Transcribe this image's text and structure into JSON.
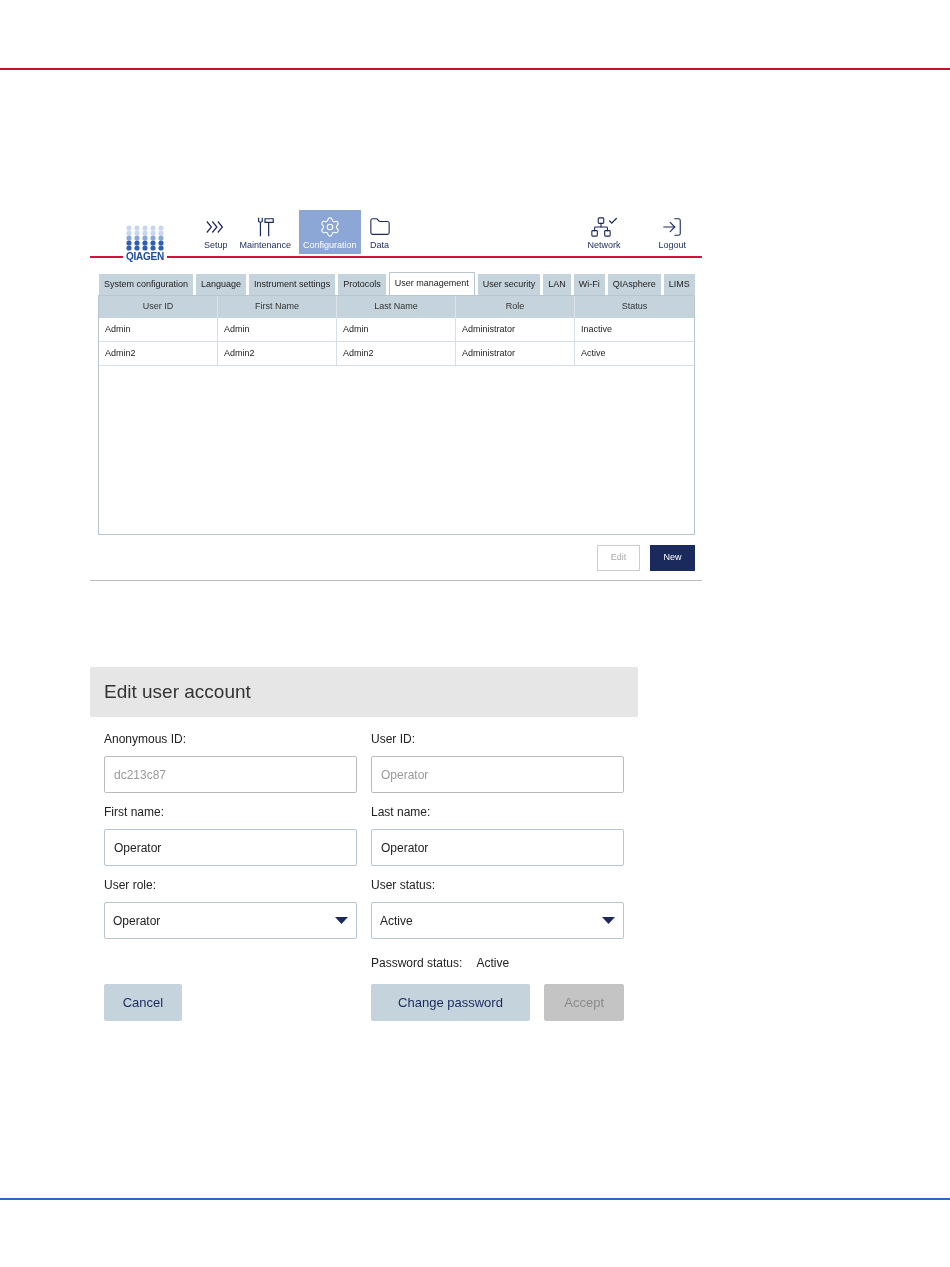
{
  "app": {
    "logo": "QIAGEN",
    "nav": [
      {
        "label": "Setup",
        "kind": "setup",
        "selected": false
      },
      {
        "label": "Maintenance",
        "kind": "maintenance",
        "selected": false
      },
      {
        "label": "Configuration",
        "kind": "configuration",
        "selected": true
      },
      {
        "label": "Data",
        "kind": "data",
        "selected": false
      }
    ],
    "nav_right": [
      {
        "label": "Network",
        "kind": "network"
      },
      {
        "label": "Logout",
        "kind": "logout"
      }
    ],
    "tabs": [
      {
        "label": "System configuration",
        "selected": false
      },
      {
        "label": "Language",
        "selected": false
      },
      {
        "label": "Instrument settings",
        "selected": false
      },
      {
        "label": "Protocols",
        "selected": false
      },
      {
        "label": "User management",
        "selected": true
      },
      {
        "label": "User security",
        "selected": false
      },
      {
        "label": "LAN",
        "selected": false
      },
      {
        "label": "Wi-Fi",
        "selected": false
      },
      {
        "label": "QIAsphere",
        "selected": false
      },
      {
        "label": "LIMS",
        "selected": false
      }
    ],
    "table": {
      "columns": [
        "User ID",
        "First Name",
        "Last Name",
        "Role",
        "Status"
      ],
      "rows": [
        [
          "Admin",
          "Admin",
          "Admin",
          "Administrator",
          "Inactive"
        ],
        [
          "Admin2",
          "Admin2",
          "Admin2",
          "Administrator",
          "Active"
        ]
      ]
    },
    "buttons": [
      {
        "label": "Edit",
        "kind": "secondary",
        "disabled": true
      },
      {
        "label": "New",
        "kind": "primary",
        "disabled": false
      }
    ]
  },
  "dialog": {
    "title": "Edit user account",
    "fields": [
      {
        "label": "Anonymous ID:",
        "value": "dc213c87",
        "kind": "text",
        "disabled": true
      },
      {
        "label": "User ID:",
        "value": "Operator",
        "kind": "text",
        "disabled": true
      },
      {
        "label": "First name:",
        "value": "Operator",
        "kind": "text",
        "disabled": false
      },
      {
        "label": "Last name:",
        "value": "Operator",
        "kind": "text",
        "disabled": false
      },
      {
        "label": "User role:",
        "value": "Operator",
        "kind": "select",
        "disabled": false
      },
      {
        "label": "User status:",
        "value": "Active",
        "kind": "select",
        "disabled": false
      }
    ],
    "password_status": {
      "label": "Password status:",
      "value": "Active"
    },
    "buttons": [
      {
        "label": "Cancel",
        "disabled": false
      },
      {
        "label": "Change password",
        "disabled": false
      },
      {
        "label": "Accept",
        "disabled": true
      }
    ]
  }
}
